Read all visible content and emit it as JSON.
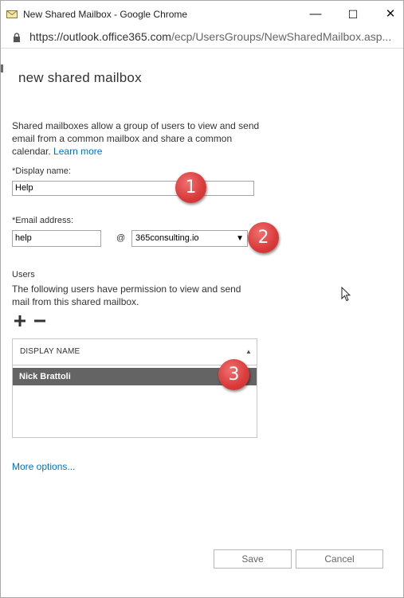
{
  "window": {
    "title": "New Shared Mailbox - Google Chrome",
    "minimize_glyph": "—",
    "maximize_glyph": "☐",
    "close_glyph": "✕"
  },
  "address": {
    "scheme_host": "https://outlook.office365.com",
    "path": "/ecp/UsersGroups/NewSharedMailbox.asp..."
  },
  "page": {
    "title": "new shared mailbox",
    "description": "Shared mailboxes allow a group of users to view and send email from a common mailbox and share a common calendar.",
    "learn_more": "Learn more"
  },
  "form": {
    "display_name_label": "*Display name:",
    "display_name_value": "Help",
    "email_label": "*Email address:",
    "email_value": "help",
    "at_sign": "@",
    "domain_value": "365consulting.io",
    "domain_arrow": "▼"
  },
  "users": {
    "label": "Users",
    "description": "The following users have permission to view and send mail from this shared mailbox.",
    "column_header": "DISPLAY NAME",
    "sort_glyph": "▲",
    "rows": [
      "Nick Brattoli"
    ]
  },
  "links": {
    "more_options": "More options..."
  },
  "buttons": {
    "save": "Save",
    "cancel": "Cancel"
  },
  "annotations": [
    "1",
    "2",
    "3"
  ],
  "colors": {
    "link": "#0072c6",
    "selected_row": "#646464",
    "badge": "#d93a3a"
  },
  "icons": [
    "mailbox-app-icon",
    "lock-icon",
    "plus-icon",
    "minus-icon",
    "sort-up-icon",
    "mouse-cursor-icon"
  ]
}
